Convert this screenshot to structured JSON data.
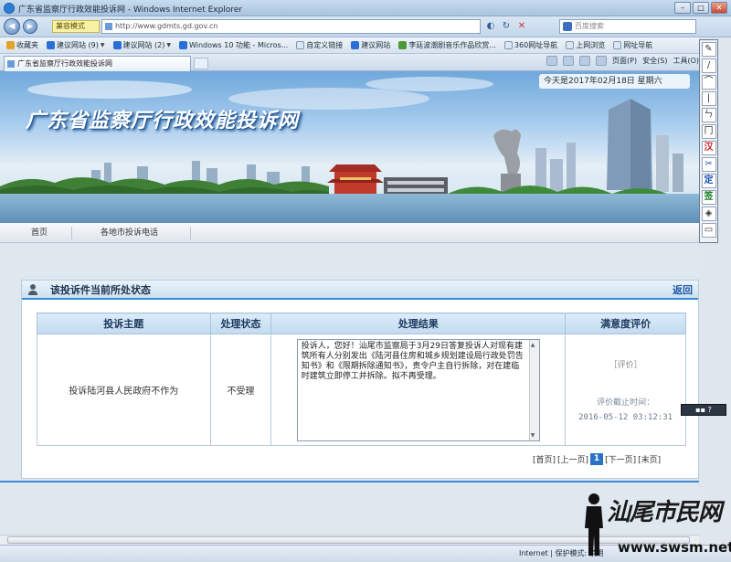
{
  "window": {
    "title": "广东省监察厅行政效能投诉网 - Windows Internet Explorer"
  },
  "address_bar": {
    "compat_label": "兼容模式",
    "url": "http://www.gdmts.gd.gov.cn",
    "search_placeholder": "百度搜索"
  },
  "favorites_bar": {
    "items": [
      {
        "label": "收藏夹",
        "icon": "star-icon"
      },
      {
        "label": "建议网站 (9)",
        "icon": "suggested-sites-icon"
      },
      {
        "label": "建议网站 (2)",
        "icon": "suggested-sites-icon"
      },
      {
        "label": "Windows 10 功能 - Micros...",
        "icon": "windows-icon"
      },
      {
        "label": "自定义链接",
        "icon": "page-icon"
      },
      {
        "label": "建议网站",
        "icon": "suggested-sites-icon"
      },
      {
        "label": "李廷波潮剧音乐作品欣赏...",
        "icon": "music-icon"
      },
      {
        "label": "360网址导航",
        "icon": "page-icon"
      },
      {
        "label": "上网浏览",
        "icon": "page-icon"
      },
      {
        "label": "网址导航",
        "icon": "page-icon"
      }
    ]
  },
  "tabs": [
    {
      "label": "广东省监察厅行政效能投诉网"
    }
  ],
  "command_bar": {
    "page_label": "页面(P)",
    "safety_label": "安全(S)",
    "tools_label": "工具(O)"
  },
  "banner": {
    "site_title": "广东省监察厅行政效能投诉网",
    "date_text": "今天是2017年02月18日 星期六"
  },
  "nav": {
    "home": "首页",
    "hotline": "各地市投诉电话"
  },
  "panel": {
    "title": "该投诉件当前所处状态",
    "back_label": "返回"
  },
  "table": {
    "headers": [
      "投诉主题",
      "处理状态",
      "处理结果",
      "满意度评价"
    ],
    "row": {
      "subject": "投诉陆河县人民政府不作为",
      "status": "不受理",
      "result": "投诉人，您好！汕尾市监察局于3月29日答复投诉人对现有建筑所有人分别发出《陆河县住房和城乡规划建设局行政处罚告知书》和《限期拆除通知书》，责令户主自行拆除，对在建临时建筑立即停工并拆除。拟不再受理。",
      "rating_button": "［评价］",
      "deadline_label": "评价截止时间：",
      "deadline_value": "2016-05-12 03:12:31"
    }
  },
  "pager": {
    "first": "[首页]",
    "prev": "[上一页]",
    "current": "1",
    "next": "[下一页]",
    "last": "[末页]"
  },
  "status_bar": {
    "zone": "Internet | 保护模式: 禁用"
  },
  "watermark": {
    "text": "汕尾市民网",
    "url": "www.swsm.net"
  },
  "colors": {
    "accent": "#3d8ad0",
    "pager_current": "#2b73c4",
    "panel_title": "#1f3550"
  }
}
